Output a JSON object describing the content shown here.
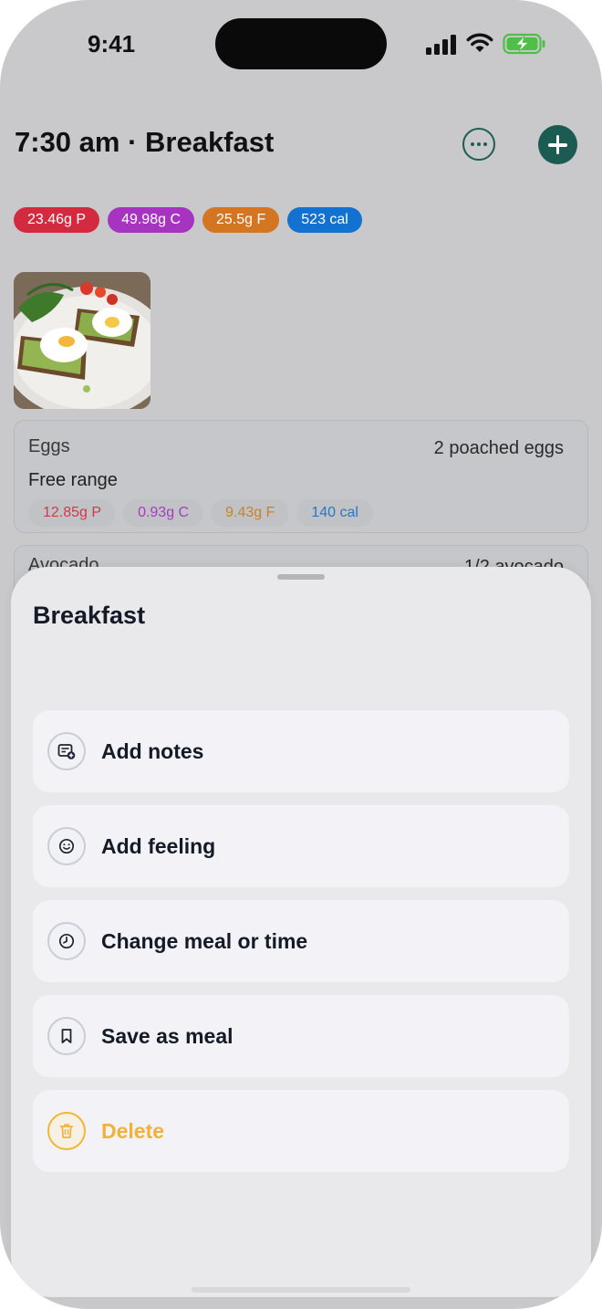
{
  "status_bar": {
    "time": "9:41"
  },
  "header": {
    "title": "7:30 am · Breakfast"
  },
  "macros": [
    {
      "label": "23.46g P",
      "color": "#d42a3f"
    },
    {
      "label": "49.98g C",
      "color": "#a734c0"
    },
    {
      "label": "25.5g F",
      "color": "#d37521"
    },
    {
      "label": "523 cal",
      "color": "#1371cf"
    }
  ],
  "foods": [
    {
      "name": "Eggs",
      "portion": "2 poached eggs",
      "description": "Free range",
      "macros": [
        {
          "label": "12.85g P",
          "color": "#cf3a4a"
        },
        {
          "label": "0.93g C",
          "color": "#a53dc0"
        },
        {
          "label": "9.43g F",
          "color": "#c98327"
        },
        {
          "label": "140 cal",
          "color": "#2c74c4"
        }
      ]
    },
    {
      "name": "Avocado",
      "portion": "1/2 avocado"
    }
  ],
  "sheet": {
    "title": "Breakfast",
    "items": [
      {
        "label": "Add notes",
        "icon": "notes-add-icon"
      },
      {
        "label": "Add feeling",
        "icon": "smiley-icon"
      },
      {
        "label": "Change meal or time",
        "icon": "clock-icon"
      },
      {
        "label": "Save as meal",
        "icon": "bookmark-icon"
      },
      {
        "label": "Delete",
        "icon": "trash-icon",
        "color": "#f0b23a"
      }
    ]
  }
}
